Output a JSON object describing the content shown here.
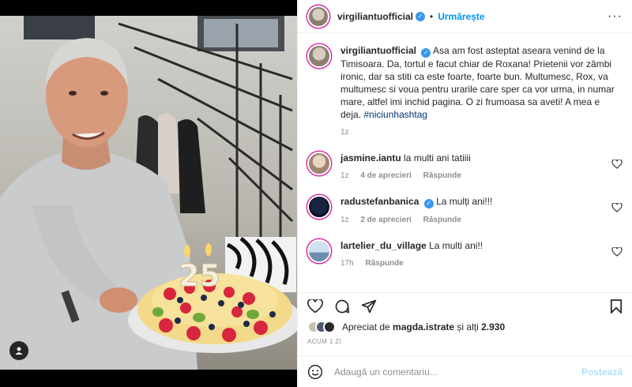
{
  "post": {
    "author": "virgiliantuofficial",
    "follow_label": "Urmărește",
    "dot": "•",
    "more_label": "···",
    "caption": "Asa am fost asteptat aseara venind de la Timisoara. Da, tortul e facut chiar de Roxana! Prietenii vor zâmbi ironic, dar sa stiti ca este foarte, foarte bun. Multumesc, Rox, va multumesc si voua pentru urarile care sper ca vor urma, in numar mare, altfel imi inchid pagina. O zi frumoasa sa aveti! A mea e deja.",
    "hashtag": "#niciunhashtag",
    "caption_time": "1z",
    "photo_candle_text": "25"
  },
  "comments": [
    {
      "user": "jasmine.iantu",
      "verified": false,
      "text": "la multi ani tatiiii",
      "time": "1z",
      "likes": "4 de aprecieri",
      "reply": "Răspunde"
    },
    {
      "user": "radustefanbanica",
      "verified": true,
      "text": "La mulți ani!!!",
      "time": "1z",
      "likes": "2 de aprecieri",
      "reply": "Răspunde"
    },
    {
      "user": "lartelier_du_village",
      "verified": false,
      "text": "La multi ani!!",
      "time": "17h",
      "likes": "",
      "reply": "Răspunde"
    }
  ],
  "likes": {
    "prefix": "Apreciat de",
    "user": "magda.istrate",
    "suffix": "și alți",
    "count": "2.930"
  },
  "time_ago": "ACUM 1 ZI",
  "add_comment": {
    "placeholder": "Adaugă un comentariu...",
    "post_label": "Postează"
  },
  "icons": {
    "like": "heart-icon",
    "comment": "comment-icon",
    "share": "share-icon",
    "save": "bookmark-icon",
    "emoji": "emoji-icon",
    "tag": "user-tag-icon",
    "verified": "verified-badge-icon"
  },
  "colors": {
    "accent": "#0095f6",
    "verified": "#3897f0",
    "post_disabled": "#b2dffc",
    "muted": "#8e8e8e"
  }
}
